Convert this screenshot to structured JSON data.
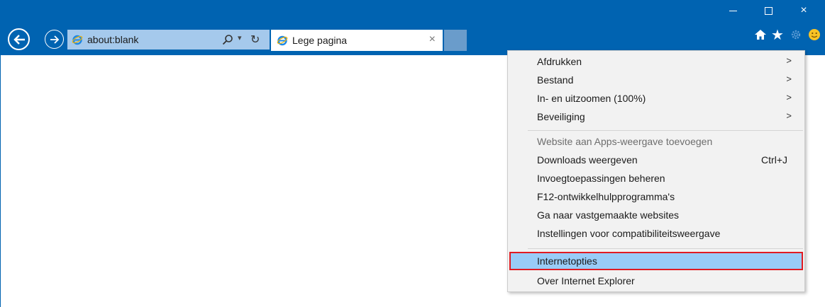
{
  "browser": {
    "address": "about:blank",
    "tab_title": "Lege pagina"
  },
  "window_controls": {
    "minimize": "—",
    "maximize": "☐",
    "close": "×"
  },
  "icons": {
    "back": "arrow-left-icon",
    "forward": "arrow-right-icon",
    "search": "search-icon",
    "refresh": "refresh-icon",
    "home": "home-icon",
    "favorites": "star-icon",
    "tools": "gear-icon",
    "feedback": "smiley-icon",
    "ie": "internet-explorer-icon"
  },
  "glyphs": {
    "search_dropdown": "▾",
    "refresh": "↻",
    "tab_close": "×",
    "star": "★",
    "submenu_arrow": ">"
  },
  "colors": {
    "titlebar": "#0063b1",
    "address_bar": "#a5c9ec",
    "menu_bg": "#f2f2f2",
    "menu_highlight": "#99ccf7",
    "highlight_border": "#e11b22"
  },
  "tools_menu": {
    "group1": [
      {
        "label": "Afdrukken",
        "arrow": ">"
      },
      {
        "label": "Bestand",
        "arrow": ">"
      },
      {
        "label": "In- en uitzoomen (100%)",
        "arrow": ">"
      },
      {
        "label": "Beveiliging",
        "arrow": ">"
      }
    ],
    "group2": [
      {
        "label": "Website aan Apps-weergave toevoegen",
        "disabled": true
      },
      {
        "label": "Downloads weergeven",
        "shortcut": "Ctrl+J"
      },
      {
        "label": "Invoegtoepassingen beheren"
      },
      {
        "label": "F12-ontwikkelhulpprogramma's"
      },
      {
        "label": "Ga naar vastgemaakte websites"
      },
      {
        "label": "Instellingen voor compatibiliteitsweergave"
      }
    ],
    "group3": [
      {
        "label": "Internetopties",
        "selected": true
      },
      {
        "label": "Over Internet Explorer"
      }
    ]
  }
}
